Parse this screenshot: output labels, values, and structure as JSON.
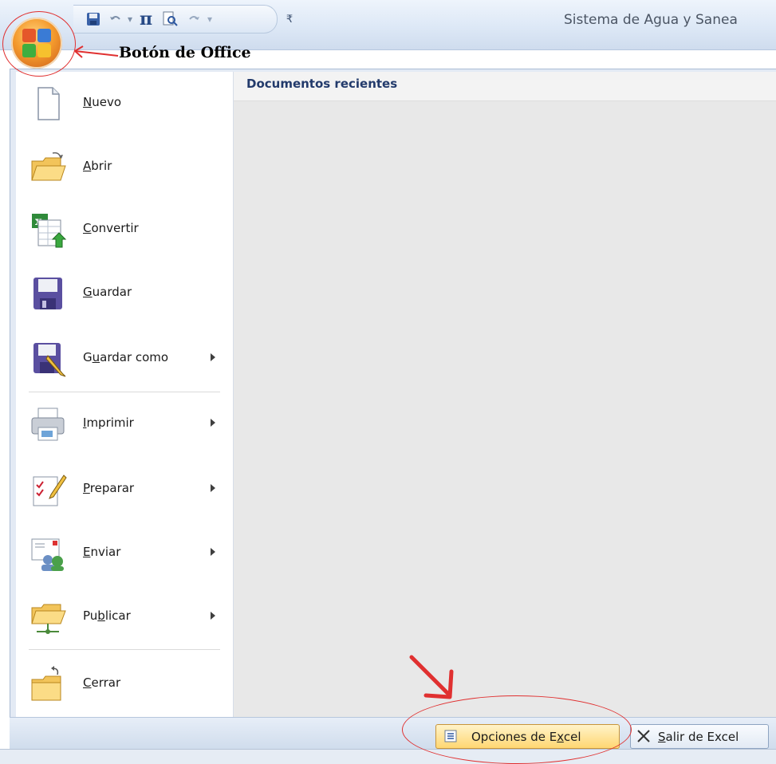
{
  "window": {
    "title": "Sistema de Agua y Sanea"
  },
  "annotation": {
    "office_button_label": "Botón de Office"
  },
  "quick_access": {
    "icons": [
      "save-icon",
      "undo-icon",
      "pi-icon",
      "print-preview-icon",
      "redo-icon",
      "customize-icon"
    ]
  },
  "recent": {
    "title": "Documentos recientes"
  },
  "menu": {
    "items": [
      {
        "pre": "",
        "mn": "N",
        "post": "uevo",
        "submenu": false
      },
      {
        "pre": "",
        "mn": "A",
        "post": "brir",
        "submenu": false
      },
      {
        "pre": "",
        "mn": "C",
        "post": "onvertir",
        "submenu": false
      },
      {
        "pre": "",
        "mn": "G",
        "post": "uardar",
        "submenu": false
      },
      {
        "pre": "G",
        "mn": "u",
        "post": "ardar como",
        "submenu": true
      },
      {
        "pre": "",
        "mn": "I",
        "post": "mprimir",
        "submenu": true
      },
      {
        "pre": "",
        "mn": "P",
        "post": "reparar",
        "submenu": true
      },
      {
        "pre": "",
        "mn": "E",
        "post": "nviar",
        "submenu": true
      },
      {
        "pre": "Pu",
        "mn": "b",
        "post": "licar",
        "submenu": true
      },
      {
        "pre": "",
        "mn": "C",
        "post": "errar",
        "submenu": false
      }
    ]
  },
  "buttons": {
    "options": {
      "pre": "Opciones de E",
      "mn": "x",
      "post": "cel"
    },
    "exit": {
      "pre": "",
      "mn": "S",
      "post": "alir de Excel"
    }
  },
  "colors": {
    "accent": "#f49a2d",
    "annotation_red": "#e03030",
    "frame": "#a9bbd4"
  }
}
